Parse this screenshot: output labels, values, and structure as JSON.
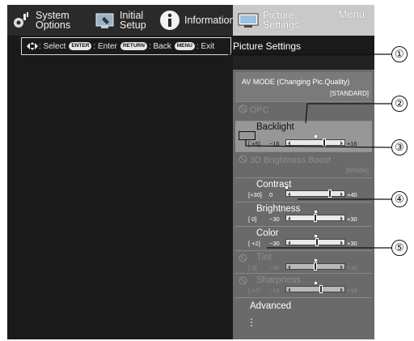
{
  "tabs": [
    {
      "label": "System\nOptions",
      "icon": "system-options-icon"
    },
    {
      "label": "Initial\nSetup",
      "icon": "initial-setup-icon"
    },
    {
      "label": "Information",
      "icon": "information-icon"
    },
    {
      "label": "Picture\nSettings",
      "icon": "picture-settings-icon",
      "active": true
    }
  ],
  "menu_label": "Menu",
  "navigation_help": {
    "select": ": Select",
    "enter_key": "ENTER",
    "enter": ": Enter",
    "return_key": "RETURN",
    "back": ": Back",
    "menu_key": "MENU",
    "exit": ": Exit"
  },
  "breadcrumb": "Picture Settings",
  "av_mode": {
    "label": "AV MODE (Changing Pic.Quality)",
    "value": "[STANDARD]"
  },
  "items": {
    "opc": {
      "label": "OPC",
      "disabled": true
    },
    "backlight": {
      "label": "Backlight",
      "value": "[ +5]",
      "min": "−16",
      "max": "+16",
      "level": 5,
      "range": [
        -16,
        16
      ]
    },
    "boost": {
      "label": "3D Brightness Boost",
      "value": "[Middle]",
      "disabled": true
    },
    "contrast": {
      "label": "Contrast",
      "value": "[+30]",
      "min": "0",
      "max": "+40",
      "level": 30,
      "range": [
        0,
        40
      ]
    },
    "brightness": {
      "label": "Brightness",
      "value": "[  0]",
      "min": "−30",
      "max": "+30",
      "level": 0,
      "range": [
        -30,
        30
      ]
    },
    "color": {
      "label": "Color",
      "value": "[ +2]",
      "min": "−30",
      "max": "+30",
      "level": 2,
      "range": [
        -30,
        30
      ]
    },
    "tint": {
      "label": "Tint",
      "value": "[  0]",
      "min": "−30",
      "max": "+30",
      "level": 0,
      "range": [
        -30,
        30
      ],
      "disabled": true
    },
    "sharpness": {
      "label": "Sharpness",
      "value": "[ +2]",
      "min": "−10",
      "max": "+10",
      "level": 2,
      "range": [
        -10,
        10
      ],
      "disabled": true
    },
    "advanced": {
      "label": "Advanced"
    }
  },
  "more_indicator": "⋮",
  "callouts": [
    "①",
    "②",
    "③",
    "④",
    "⑤"
  ]
}
